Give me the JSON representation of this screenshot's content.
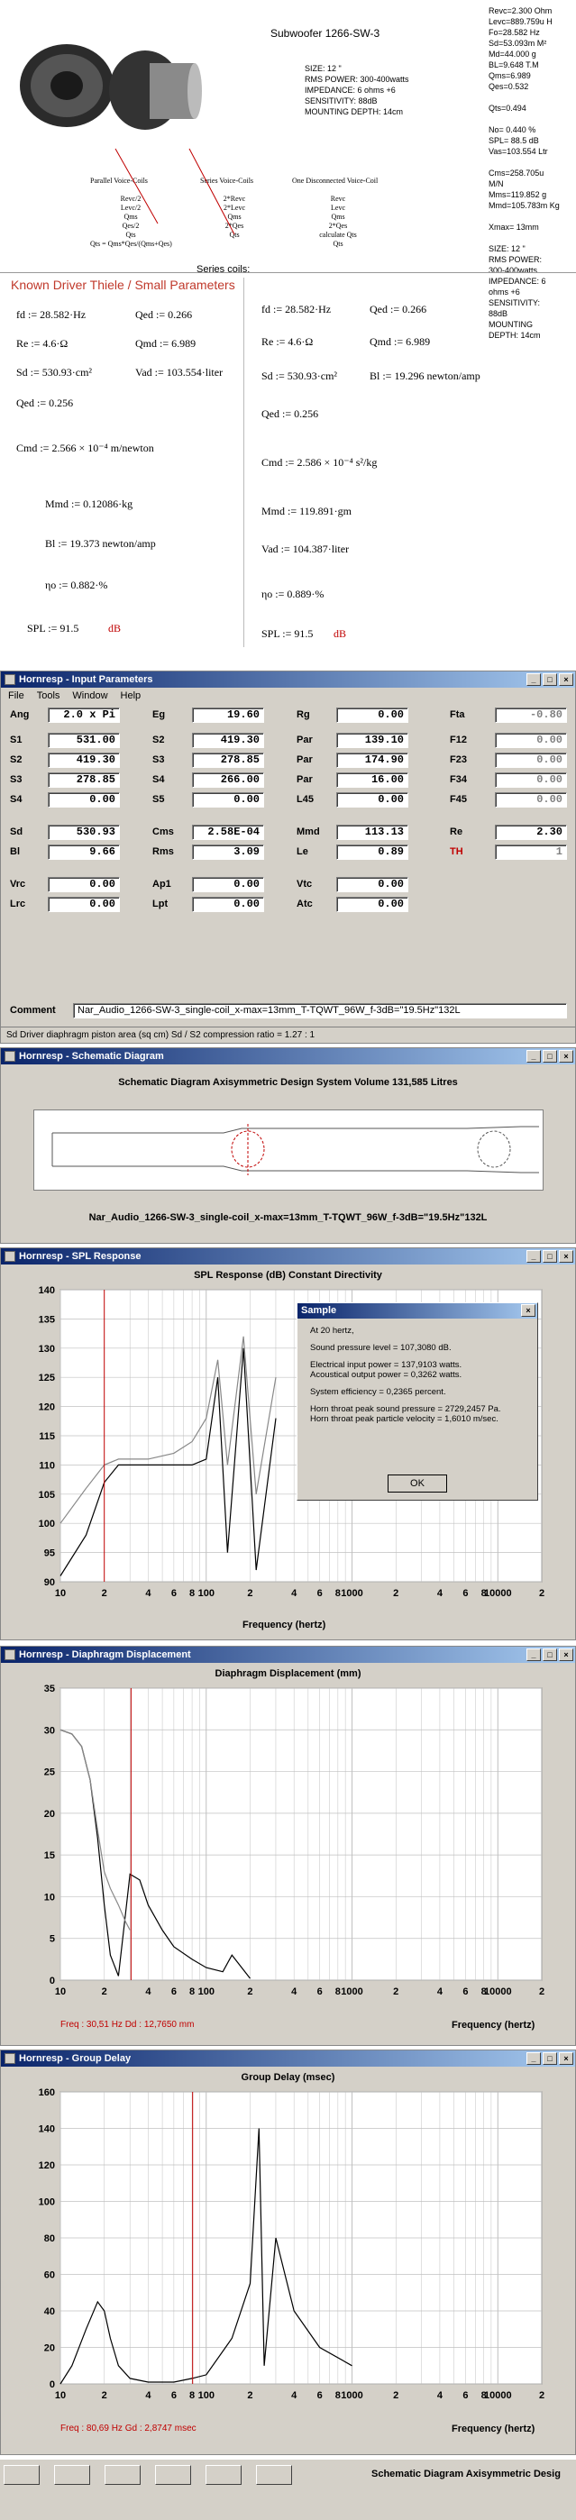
{
  "doc": {
    "title": "Subwoofer 1266-SW-3",
    "specs": [
      "SIZE: 12 \"",
      "RMS POWER: 300-400watts",
      "IMPEDANCE: 6 ohms +6",
      "SENSITIVITY: 88dB",
      "MOUNTING DEPTH: 14cm"
    ],
    "right_col": [
      "Revc=2.300 Ohm",
      "Levc=889.759u H",
      "Fo=28.582 Hz",
      "Sd=53.093m M²",
      "Md=44.000 g",
      "BL=9.648 T.M",
      "Qms=6.989",
      "Qes=0.532",
      "",
      "Qts=0.494",
      "",
      "No= 0.440 %",
      "SPL= 88.5 dB",
      "Vas=103.554 Ltr",
      "",
      "Cms=258.705u",
      "M/N",
      "Mms=119.852 g",
      "Mmd=105.783m Kg",
      "",
      "Xmax= 13mm",
      "",
      "SIZE: 12 \"",
      "RMS POWER:",
      "300-400watts",
      "IMPEDANCE: 6",
      "ohms +6",
      "SENSITIVITY:",
      "88dB",
      "MOUNTING",
      "DEPTH: 14cm"
    ],
    "coil_cols": [
      {
        "head": "Parallel Voice-Coils",
        "lines": [
          "Revc/2",
          "Levc/2",
          "Qms",
          "Qes/2",
          "Qts",
          "Qts = Qms*Qes/(Qms+Qes)"
        ]
      },
      {
        "head": "Series Voice-Coils",
        "lines": [
          "2*Revc",
          "2*Levc",
          "Qms",
          "2*Qes",
          "Qts"
        ]
      },
      {
        "head": "One Disconnected Voice-Coil",
        "lines": [
          "Revc",
          "Levc",
          "Qms",
          "2*Qes",
          "calculate Qts",
          "Qts"
        ]
      }
    ],
    "series_coils": "Series coils:",
    "section_title": "Known Driver Thiele / Small Parameters",
    "left_math": [
      "fd := 28.582·Hz",
      "Re := 4.6·Ω",
      "Sd := 530.93·cm²",
      "Qed := 0.256",
      "Cmd := 2.566 × 10⁻⁴ m/newton",
      "Mmd := 0.12086·kg",
      "Bl := 19.373 newton/amp",
      "ηo := 0.882·%",
      "SPL := 91.5"
    ],
    "left_math_right": [
      "Qed := 0.266",
      "Qmd := 6.989",
      "Vad := 103.554·liter"
    ],
    "right_math": [
      "fd := 28.582·Hz",
      "Re := 4.6·Ω",
      "Sd := 530.93·cm²",
      "Qed := 0.256",
      "Cmd := 2.586 × 10⁻⁴ s²/kg",
      "Mmd := 119.891·gm",
      "Vad := 104.387·liter",
      "ηo := 0.889·%",
      "SPL := 91.5"
    ],
    "right_math_right": [
      "Qed := 0.266",
      "Qmd := 6.989",
      "Bl := 19.296 newton/amp"
    ],
    "db": "dB"
  },
  "input_window": {
    "title": "Hornresp - Input Parameters",
    "menu": [
      "File",
      "Tools",
      "Window",
      "Help"
    ],
    "rows": [
      [
        [
          "Ang",
          "2.0 x Pi"
        ],
        [
          "Eg",
          "19.60"
        ],
        [
          "Rg",
          "0.00"
        ],
        [
          "Fta",
          "-0.80"
        ]
      ],
      [
        [
          "S1",
          "531.00"
        ],
        [
          "S2",
          "419.30"
        ],
        [
          "Par",
          "139.10"
        ],
        [
          "F12",
          "0.00"
        ]
      ],
      [
        [
          "S2",
          "419.30"
        ],
        [
          "S3",
          "278.85"
        ],
        [
          "Par",
          "174.90"
        ],
        [
          "F23",
          "0.00"
        ]
      ],
      [
        [
          "S3",
          "278.85"
        ],
        [
          "S4",
          "266.00"
        ],
        [
          "Par",
          "16.00"
        ],
        [
          "F34",
          "0.00"
        ]
      ],
      [
        [
          "S4",
          "0.00"
        ],
        [
          "S5",
          "0.00"
        ],
        [
          "L45",
          "0.00"
        ],
        [
          "F45",
          "0.00"
        ]
      ],
      [
        [
          "Sd",
          "530.93"
        ],
        [
          "Cms",
          "2.58E-04"
        ],
        [
          "Mmd",
          "113.13"
        ],
        [
          "Re",
          "2.30"
        ]
      ],
      [
        [
          "Bl",
          "9.66"
        ],
        [
          "Rms",
          "3.09"
        ],
        [
          "Le",
          "0.89"
        ],
        [
          "TH",
          "1"
        ]
      ],
      [
        [
          "Vrc",
          "0.00"
        ],
        [
          "Ap1",
          "0.00"
        ],
        [
          "Vtc",
          "0.00"
        ],
        [
          "",
          ""
        ]
      ],
      [
        [
          "Lrc",
          "0.00"
        ],
        [
          "Lpt",
          "0.00"
        ],
        [
          "Atc",
          "0.00"
        ],
        [
          "",
          ""
        ]
      ]
    ],
    "comment_label": "Comment",
    "comment": "Nar_Audio_1266-SW-3_single-coil_x-max=13mm_T-TQWT_96W_f-3dB=\"19.5Hz\"132L",
    "status": "Sd   Driver diaphragm piston area  (sq cm)   Sd / S2 compression ratio = 1.27 : 1"
  },
  "schematic_window": {
    "title": "Hornresp - Schematic Diagram",
    "heading": "Schematic Diagram    Axisymmetric Design    System Volume 131,585 Litres",
    "caption": "Nar_Audio_1266-SW-3_single-coil_x-max=13mm_T-TQWT_96W_f-3dB=\"19.5Hz\"132L"
  },
  "spl_window": {
    "title": "Hornresp - SPL Response",
    "heading": "SPL Response (dB)    Constant Directivity",
    "xlabel": "Frequency (hertz)",
    "dialog": {
      "title": "Sample",
      "lines": [
        "At 20 hertz,",
        "",
        "Sound pressure level = 107,3080 dB.",
        "",
        "Electrical input power = 137,9103 watts.",
        "Acoustical output power = 0,3262 watts.",
        "",
        "System efficiency = 0,2365 percent.",
        "",
        "Horn throat peak sound pressure = 2729,2457 Pa.",
        "Horn throat peak particle velocity = 1,6010 m/sec."
      ],
      "ok": "OK"
    }
  },
  "disp_window": {
    "title": "Hornresp - Diaphragm Displacement",
    "heading": "Diaphragm Displacement (mm)",
    "xlabel": "Frequency (hertz)",
    "readout": "Freq : 30,51 Hz     Dd : 12,7650 mm"
  },
  "gd_window": {
    "title": "Hornresp - Group Delay",
    "heading": "Group Delay (msec)",
    "xlabel": "Frequency (hertz)",
    "readout": "Freq : 80,69 Hz     Gd : 2,8747 msec"
  },
  "taskbar": {
    "text": "Schematic Diagram    Axisymmetric Desig"
  },
  "chart_data": [
    {
      "type": "line",
      "title": "SPL Response (dB)    Constant Directivity",
      "xlabel": "Frequency (hertz)",
      "xscale": "log",
      "xlim": [
        10,
        20000
      ],
      "ylim": [
        90,
        140
      ],
      "yticks": [
        90,
        95,
        100,
        105,
        110,
        115,
        120,
        125,
        130,
        135,
        140
      ],
      "xticks": [
        "10",
        "2",
        "4",
        "6 8 100",
        "2",
        "4",
        "6 8 1000",
        "2",
        "4",
        "6 8 10000",
        "2"
      ],
      "marker_hz": 20,
      "series": [
        {
          "x": [
            10,
            15,
            20,
            25,
            30,
            40,
            60,
            80,
            100,
            120,
            140,
            180,
            220,
            300
          ],
          "y": [
            91,
            98,
            107,
            110,
            110,
            110,
            110,
            110,
            111,
            125,
            95,
            130,
            92,
            118
          ]
        },
        {
          "x": [
            10,
            15,
            20,
            25,
            30,
            40,
            60,
            80,
            100,
            120,
            140,
            180,
            220,
            300
          ],
          "y": [
            100,
            106,
            110,
            111,
            111,
            111,
            112,
            114,
            118,
            128,
            110,
            132,
            105,
            125
          ]
        }
      ]
    },
    {
      "type": "line",
      "title": "Diaphragm Displacement (mm)",
      "xlabel": "Frequency (hertz)",
      "xscale": "log",
      "xlim": [
        10,
        20000
      ],
      "ylim": [
        0,
        35
      ],
      "yticks": [
        0,
        5,
        10,
        15,
        20,
        25,
        30,
        35
      ],
      "marker_hz": 30.51,
      "series": [
        {
          "x": [
            10,
            12,
            14,
            16,
            18,
            20,
            22,
            25,
            28,
            30,
            35,
            40,
            50,
            60,
            80,
            100,
            130,
            150,
            200
          ],
          "y": [
            30,
            29.5,
            28,
            24,
            17,
            9,
            3,
            0.5,
            8,
            12.7,
            12,
            9,
            6,
            4,
            2.5,
            1.5,
            1,
            3,
            0.2
          ]
        },
        {
          "x": [
            10,
            12,
            14,
            16,
            18,
            20,
            22,
            25,
            28,
            30
          ],
          "y": [
            30,
            29.5,
            28,
            24,
            18,
            13,
            11,
            9,
            7,
            6
          ]
        }
      ]
    },
    {
      "type": "line",
      "title": "Group Delay (msec)",
      "xlabel": "Frequency (hertz)",
      "xscale": "log",
      "xlim": [
        10,
        20000
      ],
      "ylim": [
        0,
        160
      ],
      "yticks": [
        0,
        20,
        40,
        60,
        80,
        100,
        120,
        140,
        160
      ],
      "marker_hz": 80.69,
      "series": [
        {
          "x": [
            10,
            12,
            15,
            18,
            20,
            22,
            25,
            30,
            40,
            60,
            80,
            100,
            150,
            200,
            230,
            250,
            300,
            400,
            600,
            1000
          ],
          "y": [
            0,
            10,
            30,
            45,
            40,
            25,
            10,
            3,
            1,
            1,
            3,
            5,
            25,
            55,
            140,
            10,
            80,
            40,
            20,
            10
          ]
        }
      ]
    }
  ],
  "colors": {
    "title_active": "#0a246a",
    "red_marker": "#c00000",
    "window_bg": "#d4d0c8",
    "grid": "#c0c0c0"
  }
}
